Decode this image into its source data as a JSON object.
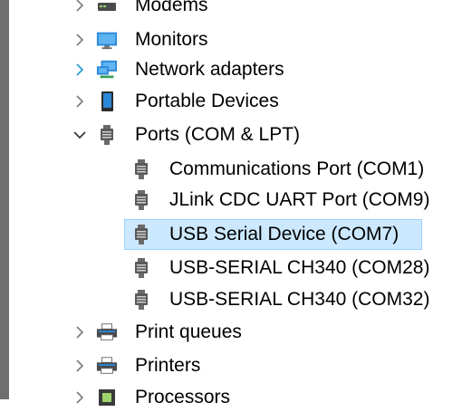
{
  "tree": {
    "items": [
      {
        "label": "Modems",
        "expander": "collapsed",
        "icon": "modem-icon"
      },
      {
        "label": "Monitors",
        "expander": "collapsed",
        "icon": "monitor-icon"
      },
      {
        "label": "Network adapters",
        "expander": "collapsed",
        "icon": "network-adapter-icon"
      },
      {
        "label": "Portable Devices",
        "expander": "collapsed",
        "icon": "portable-device-icon"
      },
      {
        "label": "Ports (COM & LPT)",
        "expander": "expanded",
        "icon": "port-icon",
        "children": [
          {
            "label": "Communications Port (COM1)",
            "icon": "port-icon"
          },
          {
            "label": "JLink CDC UART Port (COM9)",
            "icon": "port-icon"
          },
          {
            "label": "USB Serial Device (COM7)",
            "icon": "port-icon",
            "selected": true
          },
          {
            "label": "USB-SERIAL CH340 (COM28)",
            "icon": "port-icon"
          },
          {
            "label": "USB-SERIAL CH340 (COM32)",
            "icon": "port-icon"
          }
        ]
      },
      {
        "label": "Print queues",
        "expander": "collapsed",
        "icon": "printer-icon"
      },
      {
        "label": "Printers",
        "expander": "collapsed",
        "icon": "printer-icon"
      },
      {
        "label": "Processors",
        "expander": "collapsed",
        "icon": "processor-icon"
      }
    ]
  },
  "colors": {
    "selection_fill": "#cce8ff",
    "selection_border": "#99d1ff",
    "chevron": "#7a7a7a",
    "chevron_hover": "#1e9bd7"
  }
}
